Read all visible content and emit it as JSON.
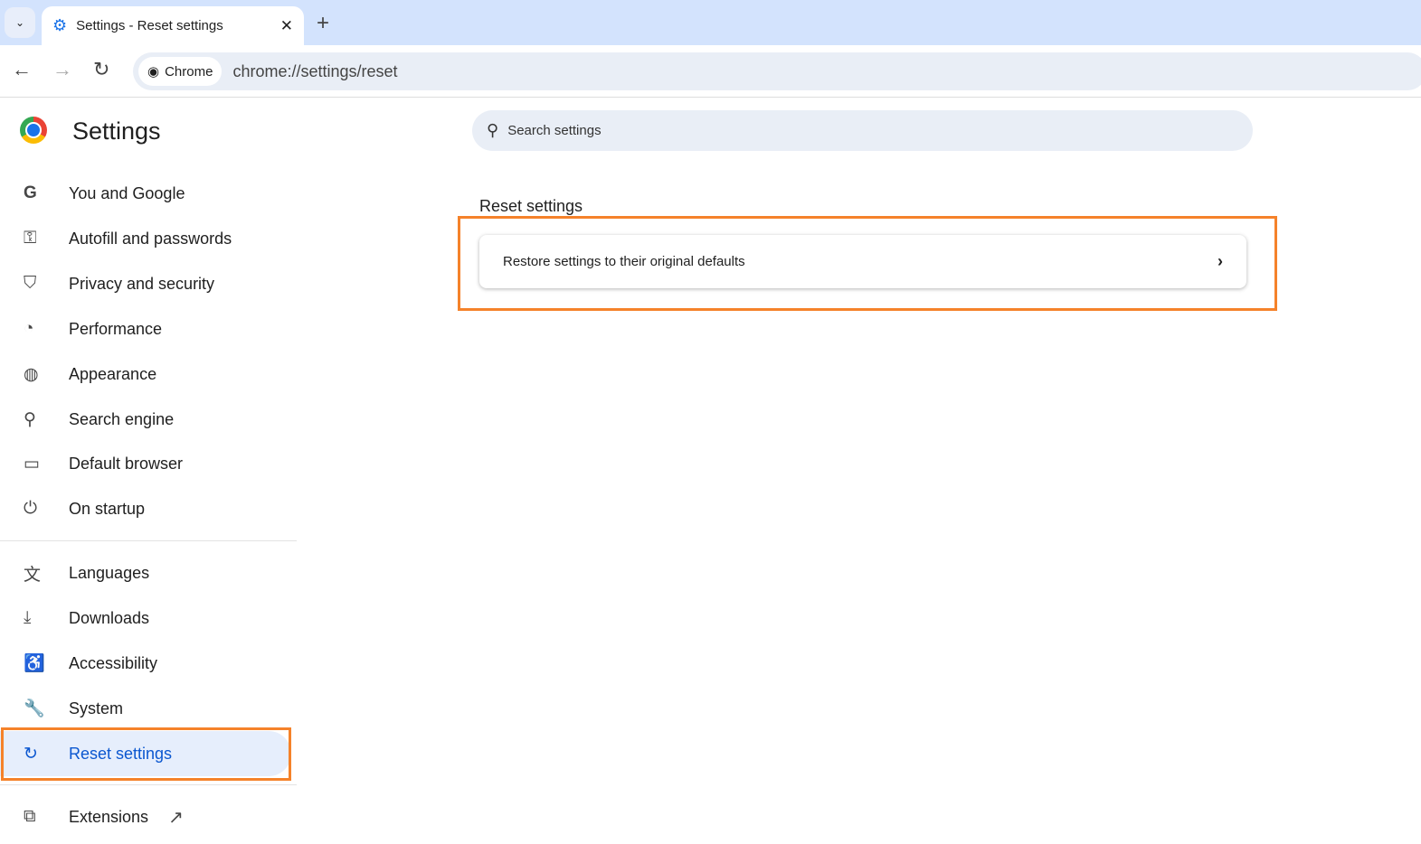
{
  "browser": {
    "tab_title": "Settings - Reset settings",
    "chip_label": "Chrome",
    "url": "chrome://settings/reset"
  },
  "settings": {
    "title": "Settings",
    "search_placeholder": "Search settings"
  },
  "sidebar": {
    "items": [
      {
        "label": "You and Google",
        "icon": "google-icon"
      },
      {
        "label": "Autofill and passwords",
        "icon": "key-icon"
      },
      {
        "label": "Privacy and security",
        "icon": "shield-icon"
      },
      {
        "label": "Performance",
        "icon": "speedometer-icon"
      },
      {
        "label": "Appearance",
        "icon": "palette-icon"
      },
      {
        "label": "Search engine",
        "icon": "search-icon"
      },
      {
        "label": "Default browser",
        "icon": "browser-icon"
      },
      {
        "label": "On startup",
        "icon": "power-icon"
      },
      {
        "label": "Languages",
        "icon": "translate-icon"
      },
      {
        "label": "Downloads",
        "icon": "download-icon"
      },
      {
        "label": "Accessibility",
        "icon": "accessibility-icon"
      },
      {
        "label": "System",
        "icon": "wrench-icon"
      },
      {
        "label": "Reset settings",
        "icon": "reset-icon"
      },
      {
        "label": "Extensions",
        "icon": "puzzle-icon"
      }
    ]
  },
  "main": {
    "section_title": "Reset settings",
    "restore_label": "Restore settings to their original defaults"
  },
  "colors": {
    "accent": "#0b57d0",
    "highlight": "#f5822a"
  }
}
